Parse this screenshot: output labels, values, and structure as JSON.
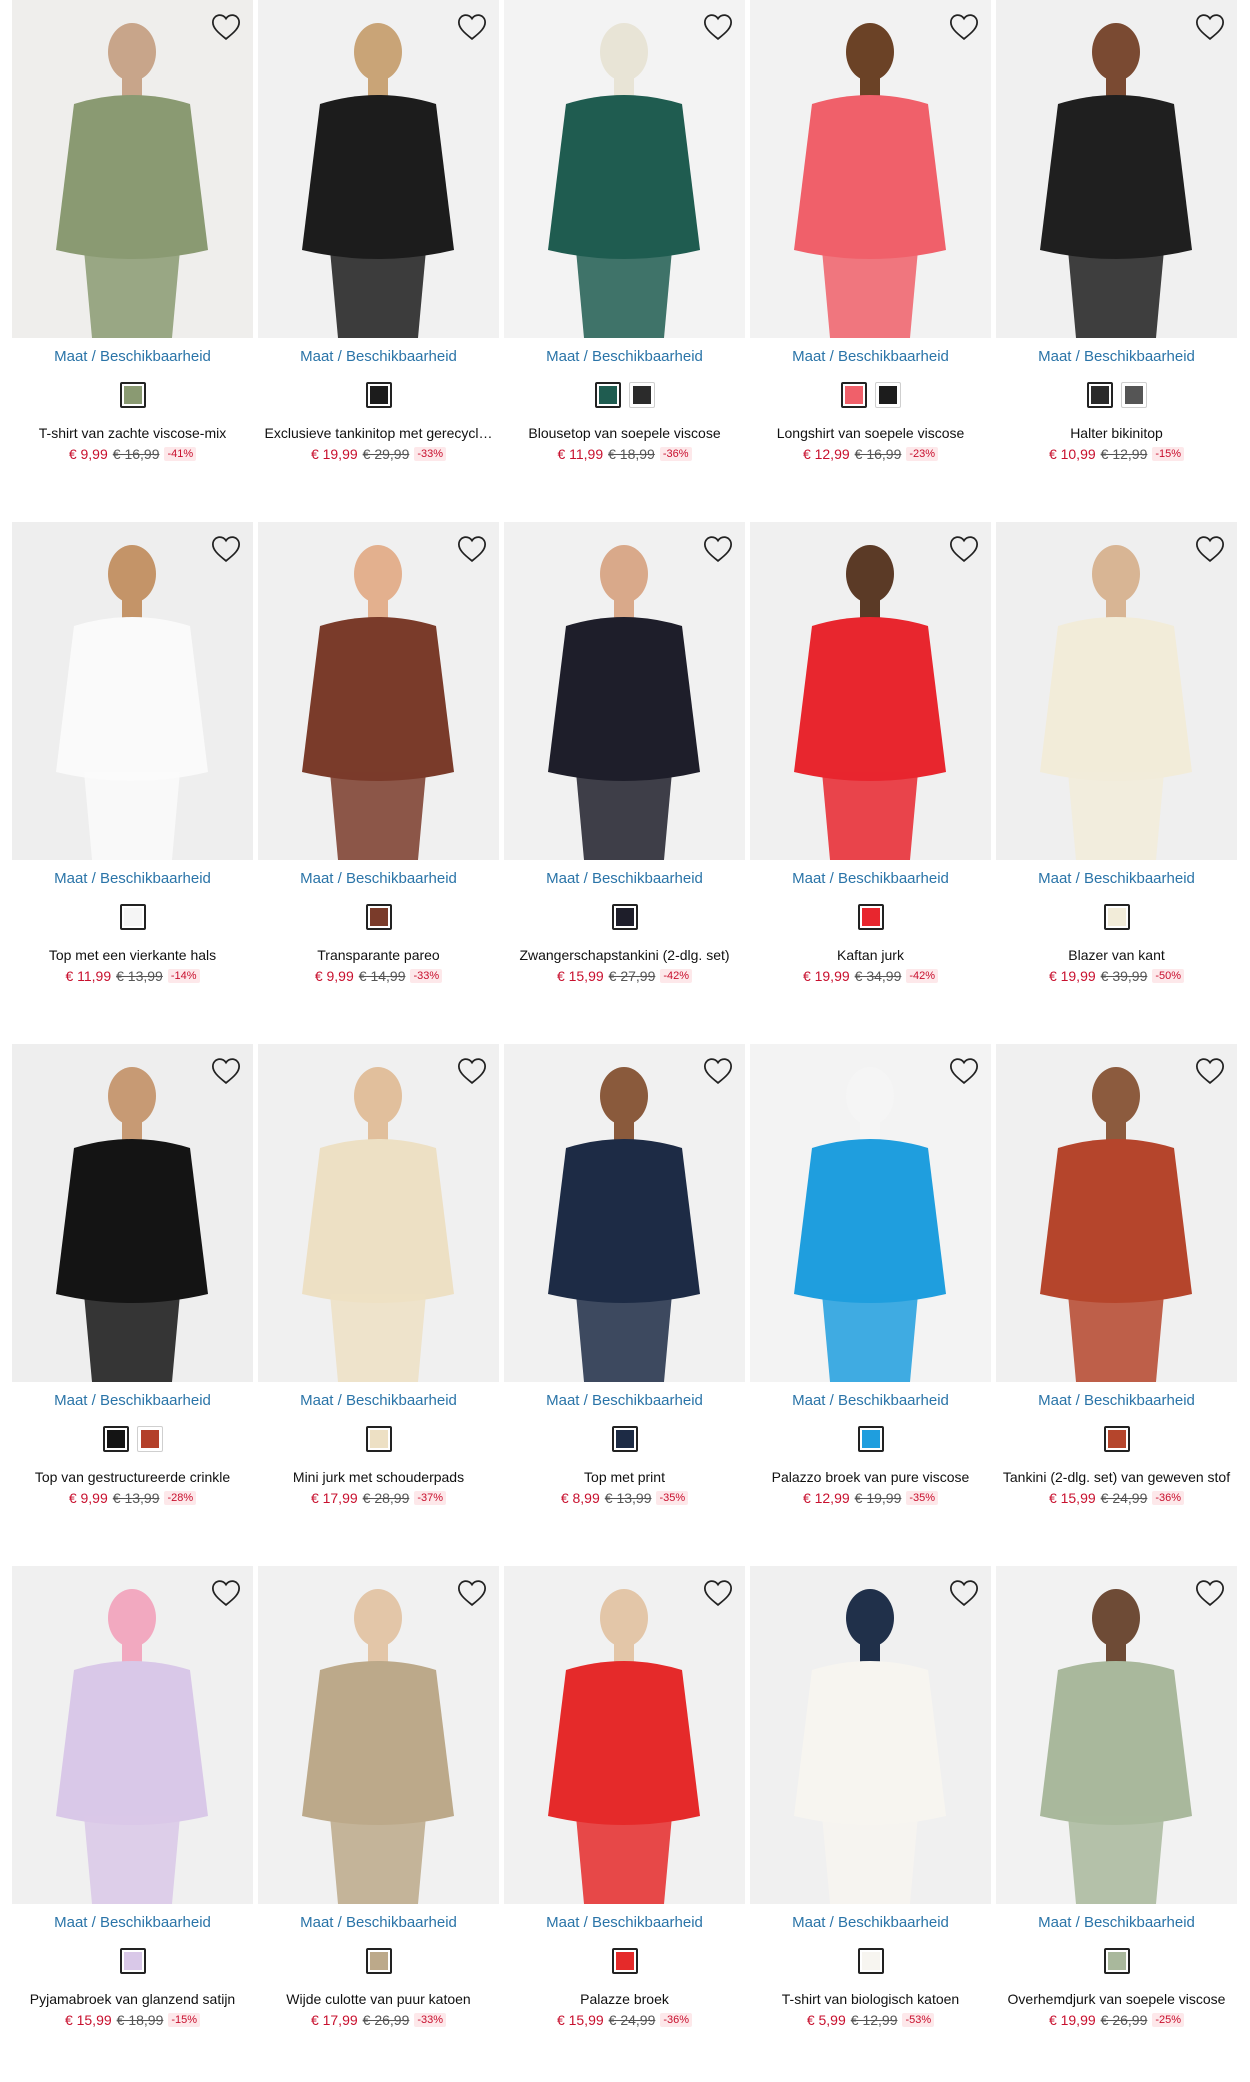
{
  "products": [
    {
      "name": "T-shirt van zachte viscose-mix",
      "size_link": "Maat / Beschikbaarheid",
      "price": "€ 9,99",
      "old_price": "€ 16,99",
      "discount": "-41%",
      "photo": {
        "bg": "#efeeec",
        "main": "#8a9a72",
        "accent": "#c8a58a"
      },
      "swatches": [
        "#8a9a72"
      ]
    },
    {
      "name": "Exclusieve tankinitop met gerecycl…",
      "size_link": "Maat / Beschikbaarheid",
      "price": "€ 19,99",
      "old_price": "€ 29,99",
      "discount": "-33%",
      "photo": {
        "bg": "#f1f1f1",
        "main": "#1c1c1c",
        "accent": "#c9a477"
      },
      "swatches": [
        "#1c1c1c"
      ]
    },
    {
      "name": "Blousetop van soepele viscose",
      "size_link": "Maat / Beschikbaarheid",
      "price": "€ 11,99",
      "old_price": "€ 18,99",
      "discount": "-36%",
      "photo": {
        "bg": "#f3f3f3",
        "main": "#1f5c50",
        "accent": "#e8e4d6"
      },
      "swatches": [
        "#1f5c50",
        "#2b2b2b"
      ]
    },
    {
      "name": "Longshirt van soepele viscose",
      "size_link": "Maat / Beschikbaarheid",
      "price": "€ 12,99",
      "old_price": "€ 16,99",
      "discount": "-23%",
      "photo": {
        "bg": "#f2f2f2",
        "main": "#f0606a",
        "accent": "#6b4226"
      },
      "swatches": [
        "#f0606a",
        "#1c1c1c"
      ]
    },
    {
      "name": "Halter bikinitop",
      "size_link": "Maat / Beschikbaarheid",
      "price": "€ 10,99",
      "old_price": "€ 12,99",
      "discount": "-15%",
      "photo": {
        "bg": "#f0f0f0",
        "main": "#1f1f1f",
        "accent": "#7a4a32"
      },
      "swatches": [
        "#2a2a2a",
        "#555555"
      ]
    },
    {
      "name": "Top met een vierkante hals",
      "size_link": "Maat / Beschikbaarheid",
      "price": "€ 11,99",
      "old_price": "€ 13,99",
      "discount": "-14%",
      "photo": {
        "bg": "#eeeeee",
        "main": "#fafafa",
        "accent": "#c49468"
      },
      "swatches": [
        "#f5f5f5"
      ]
    },
    {
      "name": "Transparante pareo",
      "size_link": "Maat / Beschikbaarheid",
      "price": "€ 9,99",
      "old_price": "€ 14,99",
      "discount": "-33%",
      "photo": {
        "bg": "#f0f0f0",
        "main": "#7a3b2a",
        "accent": "#e3b08e"
      },
      "swatches": [
        "#7a3b2a"
      ]
    },
    {
      "name": "Zwangerschapstankini (2-dlg. set)",
      "size_link": "Maat / Beschikbaarheid",
      "price": "€ 15,99",
      "old_price": "€ 27,99",
      "discount": "-42%",
      "photo": {
        "bg": "#f1f1f1",
        "main": "#1e1e2a",
        "accent": "#d9a98a"
      },
      "swatches": [
        "#1e1e2a"
      ]
    },
    {
      "name": "Kaftan jurk",
      "size_link": "Maat / Beschikbaarheid",
      "price": "€ 19,99",
      "old_price": "€ 34,99",
      "discount": "-42%",
      "photo": {
        "bg": "#f0f0f0",
        "main": "#e8262e",
        "accent": "#5b3a26"
      },
      "swatches": [
        "#e8262e"
      ]
    },
    {
      "name": "Blazer van kant",
      "size_link": "Maat / Beschikbaarheid",
      "price": "€ 19,99",
      "old_price": "€ 39,99",
      "discount": "-50%",
      "photo": {
        "bg": "#efefef",
        "main": "#f2ecd9",
        "accent": "#d8b594"
      },
      "swatches": [
        "#f2ecd9"
      ]
    },
    {
      "name": "Top van gestructureerde crinkle",
      "size_link": "Maat / Beschikbaarheid",
      "price": "€ 9,99",
      "old_price": "€ 13,99",
      "discount": "-28%",
      "photo": {
        "bg": "#eeeeee",
        "main": "#141414",
        "accent": "#c79a74"
      },
      "swatches": [
        "#141414",
        "#b3402a"
      ]
    },
    {
      "name": "Mini jurk met schouderpads",
      "size_link": "Maat / Beschikbaarheid",
      "price": "€ 17,99",
      "old_price": "€ 28,99",
      "discount": "-37%",
      "photo": {
        "bg": "#f0f0f0",
        "main": "#ede0c4",
        "accent": "#e1bf9c"
      },
      "swatches": [
        "#ede0c4"
      ]
    },
    {
      "name": "Top met print",
      "size_link": "Maat / Beschikbaarheid",
      "price": "€ 8,99",
      "old_price": "€ 13,99",
      "discount": "-35%",
      "photo": {
        "bg": "#f1f1f1",
        "main": "#1d2b45",
        "accent": "#8a5a3c"
      },
      "swatches": [
        "#1d2b45"
      ]
    },
    {
      "name": "Palazzo broek van pure viscose",
      "size_link": "Maat / Beschikbaarheid",
      "price": "€ 12,99",
      "old_price": "€ 19,99",
      "discount": "-35%",
      "photo": {
        "bg": "#f3f3f3",
        "main": "#1f9ede",
        "accent": "#f5f5f5"
      },
      "swatches": [
        "#1f9ede"
      ]
    },
    {
      "name": "Tankini (2-dlg. set) van geweven stof",
      "size_link": "Maat / Beschikbaarheid",
      "price": "€ 15,99",
      "old_price": "€ 24,99",
      "discount": "-36%",
      "photo": {
        "bg": "#f0f0f0",
        "main": "#b5452c",
        "accent": "#8c5b3e"
      },
      "swatches": [
        "#b5452c"
      ]
    },
    {
      "name": "Pyjamabroek van glanzend satijn",
      "size_link": "Maat / Beschikbaarheid",
      "price": "€ 15,99",
      "old_price": "€ 18,99",
      "discount": "-15%",
      "photo": {
        "bg": "#f0f0f0",
        "main": "#d9c8e8",
        "accent": "#f2a9c0"
      },
      "swatches": [
        "#d9c8e8"
      ]
    },
    {
      "name": "Wijde culotte van puur katoen",
      "size_link": "Maat / Beschikbaarheid",
      "price": "€ 17,99",
      "old_price": "€ 26,99",
      "discount": "-33%",
      "photo": {
        "bg": "#f1f1f1",
        "main": "#bca98a",
        "accent": "#e3c6a8"
      },
      "swatches": [
        "#bca98a"
      ]
    },
    {
      "name": "Palazze broek",
      "size_link": "Maat / Beschikbaarheid",
      "price": "€ 15,99",
      "old_price": "€ 24,99",
      "discount": "-36%",
      "photo": {
        "bg": "#f1f1f1",
        "main": "#e52a2a",
        "accent": "#e3c6a8"
      },
      "swatches": [
        "#e52a2a"
      ]
    },
    {
      "name": "T-shirt van biologisch katoen",
      "size_link": "Maat / Beschikbaarheid",
      "price": "€ 5,99",
      "old_price": "€ 12,99",
      "discount": "-53%",
      "photo": {
        "bg": "#f0f0f0",
        "main": "#f7f5f0",
        "accent": "#20304a"
      },
      "swatches": [
        "#f7f5f0"
      ]
    },
    {
      "name": "Overhemdjurk van soepele viscose",
      "size_link": "Maat / Beschikbaarheid",
      "price": "€ 19,99",
      "old_price": "€ 26,99",
      "discount": "-25%",
      "photo": {
        "bg": "#f2f2f2",
        "main": "#a9b89c",
        "accent": "#6e4b36"
      },
      "swatches": [
        "#a9b89c"
      ]
    }
  ]
}
